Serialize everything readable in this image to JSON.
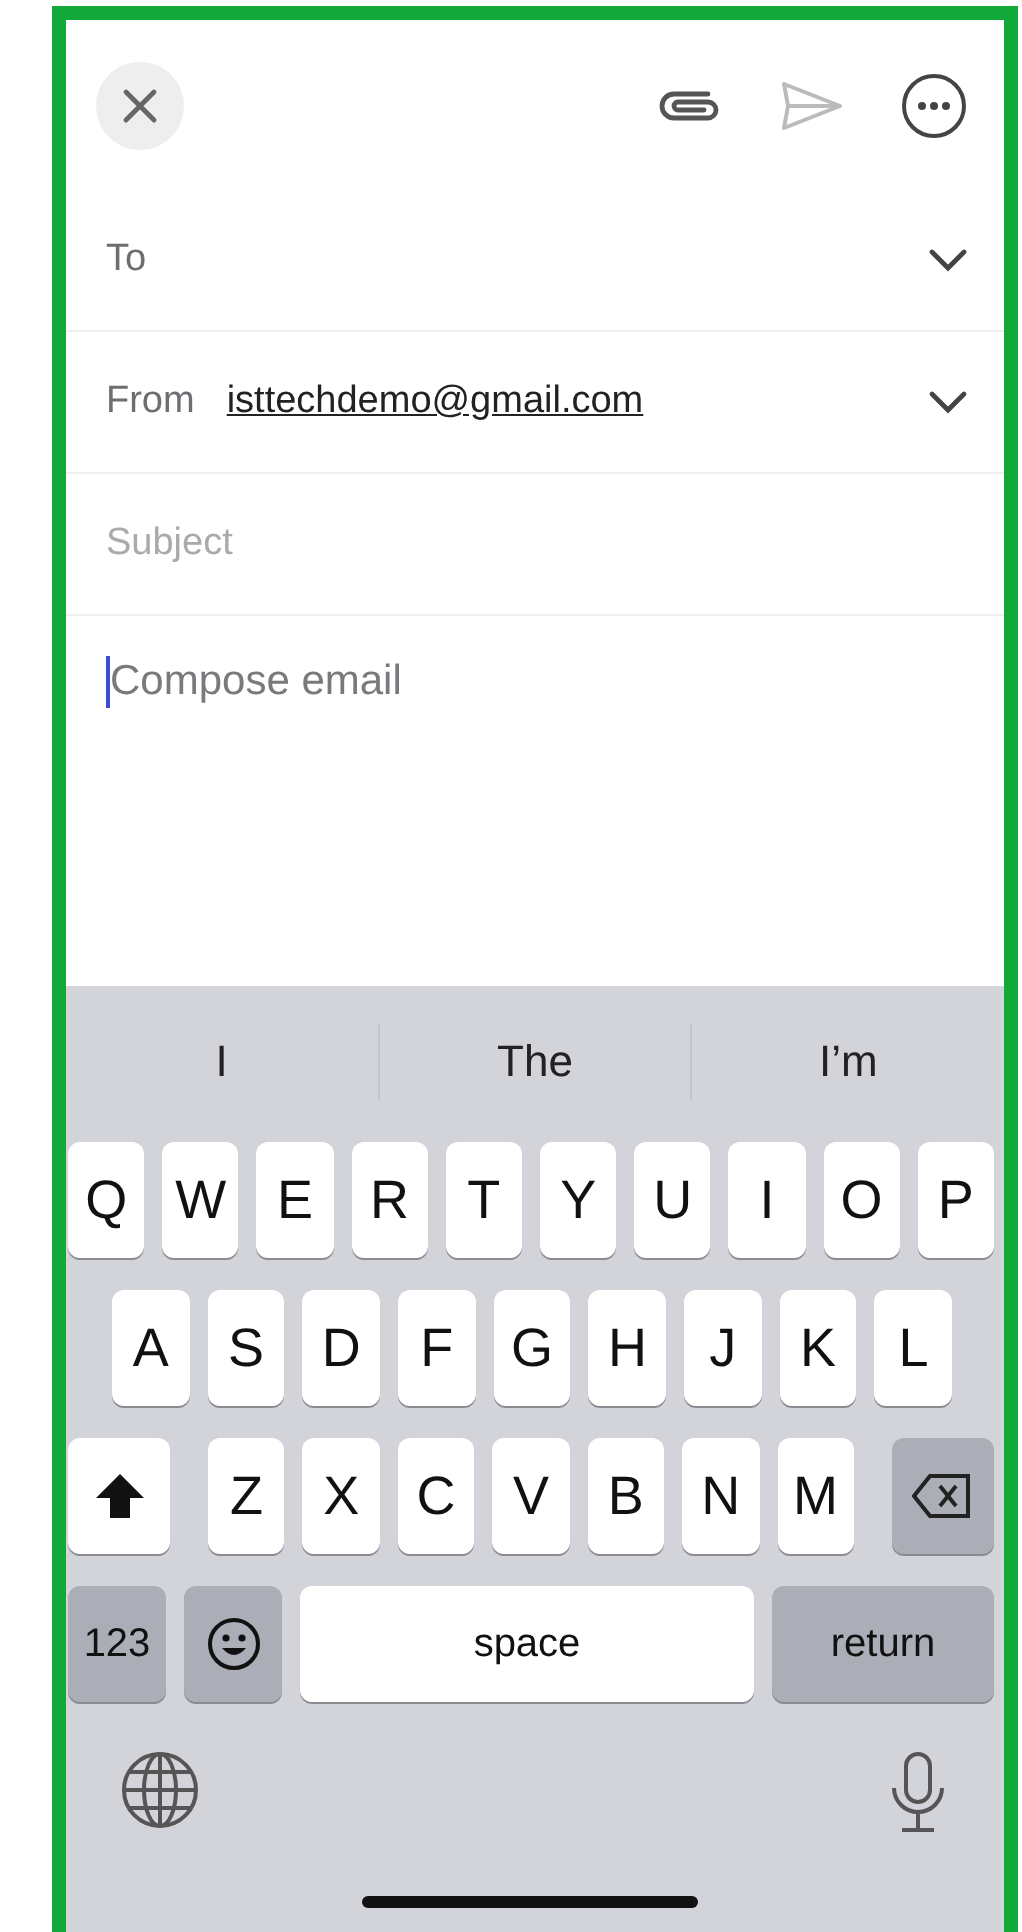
{
  "compose": {
    "to_label": "To",
    "from_label": "From",
    "from_value": "isttechdemo@gmail.com",
    "subject": {
      "placeholder": "Subject"
    },
    "body": {
      "placeholder": "Compose email"
    }
  },
  "suggestions": [
    "I",
    "The",
    "I’m"
  ],
  "keyboard": {
    "rows": [
      {
        "keys": [
          {
            "kind": "letter",
            "label": "Q"
          },
          {
            "kind": "letter",
            "label": "W"
          },
          {
            "kind": "letter",
            "label": "E"
          },
          {
            "kind": "letter",
            "label": "R"
          },
          {
            "kind": "letter",
            "label": "T"
          },
          {
            "kind": "letter",
            "label": "Y"
          },
          {
            "kind": "letter",
            "label": "U"
          },
          {
            "kind": "letter",
            "label": "I"
          },
          {
            "kind": "letter",
            "label": "O"
          },
          {
            "kind": "letter",
            "label": "P"
          }
        ]
      },
      {
        "keys": [
          {
            "kind": "letter",
            "label": "A"
          },
          {
            "kind": "letter",
            "label": "S"
          },
          {
            "kind": "letter",
            "label": "D"
          },
          {
            "kind": "letter",
            "label": "F"
          },
          {
            "kind": "letter",
            "label": "G"
          },
          {
            "kind": "letter",
            "label": "H"
          },
          {
            "kind": "letter",
            "label": "J"
          },
          {
            "kind": "letter",
            "label": "K"
          },
          {
            "kind": "letter",
            "label": "L"
          }
        ]
      },
      {
        "keys": [
          {
            "kind": "shift",
            "on": true
          },
          {
            "kind": "letter",
            "label": "Z"
          },
          {
            "kind": "letter",
            "label": "X"
          },
          {
            "kind": "letter",
            "label": "C"
          },
          {
            "kind": "letter",
            "label": "V"
          },
          {
            "kind": "letter",
            "label": "B"
          },
          {
            "kind": "letter",
            "label": "N"
          },
          {
            "kind": "letter",
            "label": "M"
          },
          {
            "kind": "delete"
          }
        ]
      }
    ],
    "bottom_row": [
      {
        "kind": "numbers",
        "label": "123"
      },
      {
        "kind": "emoji"
      },
      {
        "kind": "space",
        "label": "space"
      },
      {
        "kind": "return",
        "label": "return"
      }
    ]
  }
}
